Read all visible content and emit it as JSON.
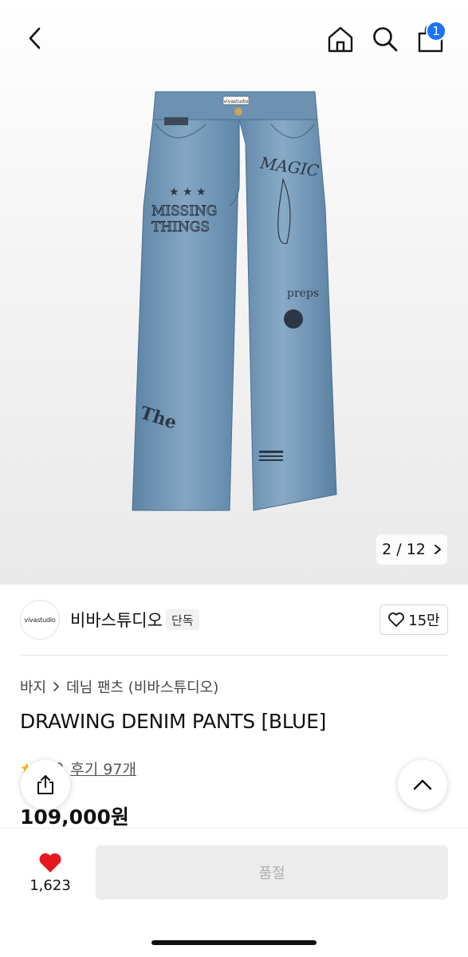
{
  "header": {
    "cart_count": "1"
  },
  "gallery": {
    "image_text": {
      "label": "vivastudio",
      "magic": "MAGIC",
      "missing": "MISSING",
      "things": "THINGS",
      "preps": "preps",
      "the": "The"
    },
    "pager_text": "2 / 12"
  },
  "brand": {
    "logo_text": "vivastudio",
    "name": "비바스튜디오",
    "tag": "단독",
    "likes": "15만"
  },
  "breadcrumb": {
    "category": "바지",
    "subcategory": "데님 팬츠 (비바스튜디오)"
  },
  "product": {
    "title": "DRAWING DENIM PANTS [BLUE]",
    "rating": "4.9",
    "review_link": "후기 97개",
    "price": "109,000원"
  },
  "bottom": {
    "wish_count": "1,623",
    "soldout_label": "품절"
  },
  "colors": {
    "accent": "#1a73ff",
    "heart": "#e8161d",
    "star": "#ffb400",
    "denim": "#6e93b2"
  }
}
